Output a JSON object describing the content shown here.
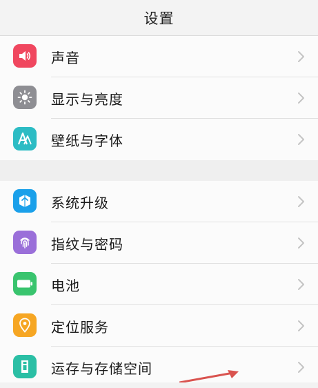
{
  "header": {
    "title": "设置"
  },
  "groups": [
    {
      "items": [
        {
          "label": "声音",
          "icon": "speaker-icon",
          "color": "#f0475f"
        },
        {
          "label": "显示与亮度",
          "icon": "brightness-icon",
          "color": "#8e8e93"
        },
        {
          "label": "壁纸与字体",
          "icon": "font-icon",
          "color": "#2cbcc4"
        }
      ]
    },
    {
      "items": [
        {
          "label": "系统升级",
          "icon": "upgrade-icon",
          "color": "#1aa0ea"
        },
        {
          "label": "指纹与密码",
          "icon": "fingerprint-icon",
          "color": "#9a6fd9"
        },
        {
          "label": "电池",
          "icon": "battery-icon",
          "color": "#39c46e"
        },
        {
          "label": "定位服务",
          "icon": "location-icon",
          "color": "#f6a623"
        },
        {
          "label": "运存与存储空间",
          "icon": "storage-icon",
          "color": "#2bbfa5"
        }
      ]
    }
  ],
  "colors": {
    "chevron": "#c4c4c4",
    "annotation_arrow": "#d9534f"
  }
}
